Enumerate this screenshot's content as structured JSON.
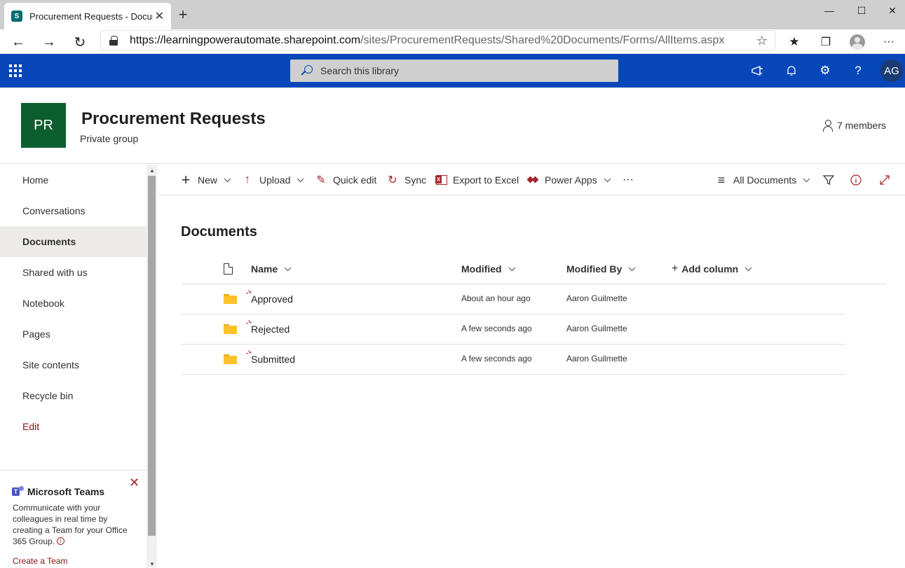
{
  "browser": {
    "tab_title": "Procurement Requests - Documents",
    "favicon_letter": "S",
    "url_host": "https://learningpowerautomate.sharepoint.com",
    "url_path": "/sites/ProcurementRequests/Shared%20Documents/Forms/AllItems.aspx",
    "minimize_glyph": "—",
    "maximize_glyph": "☐",
    "close_glyph": "✕",
    "new_tab_glyph": "+",
    "back_glyph": "←",
    "forward_glyph": "→",
    "refresh_glyph": "↻",
    "star_glyph": "☆",
    "favorites_glyph": "★",
    "menu_glyph": "···"
  },
  "suitebar": {
    "search_placeholder": "Search this library",
    "avatar_initials": "AG",
    "help_glyph": "?",
    "settings_glyph": "⚙",
    "bell_glyph": "🔔",
    "feedback_glyph": "📢"
  },
  "site": {
    "logo_initials": "PR",
    "title": "Procurement Requests",
    "subtitle": "Private group",
    "members": "7 members"
  },
  "leftnav": {
    "items": [
      {
        "label": "Home"
      },
      {
        "label": "Conversations"
      },
      {
        "label": "Documents"
      },
      {
        "label": "Shared with us"
      },
      {
        "label": "Notebook"
      },
      {
        "label": "Pages"
      },
      {
        "label": "Site contents"
      },
      {
        "label": "Recycle bin"
      },
      {
        "label": "Edit"
      }
    ],
    "selected": "Documents"
  },
  "teams_card": {
    "title": "Microsoft Teams",
    "description": "Communicate with your colleagues in real time by creating a Team for your Office 365 Group.",
    "link": "Create a Team",
    "close_glyph": "✕",
    "info_glyph": "i"
  },
  "commandbar": {
    "new": "New",
    "upload": "Upload",
    "quick_edit": "Quick edit",
    "sync": "Sync",
    "export": "Export to Excel",
    "power_apps": "Power Apps",
    "more": "···",
    "view": "All Documents",
    "new_glyph": "+",
    "upload_glyph": "↑",
    "edit_glyph": "✎",
    "sync_glyph": "↻",
    "view_glyph": "≡",
    "filter_glyph": "▽",
    "info_glyph": "ⓘ",
    "expand_glyph": "⤢"
  },
  "library": {
    "title": "Documents",
    "columns": {
      "name": "Name",
      "modified": "Modified",
      "modified_by": "Modified By",
      "add_column": "Add column",
      "add_glyph": "+"
    },
    "rows": [
      {
        "name": "Approved",
        "modified": "About an hour ago",
        "modified_by": "Aaron Guilmette"
      },
      {
        "name": "Rejected",
        "modified": "A few seconds ago",
        "modified_by": "Aaron Guilmette"
      },
      {
        "name": "Submitted",
        "modified": "A few seconds ago",
        "modified_by": "Aaron Guilmette"
      }
    ]
  },
  "colors": {
    "suitebar": "#0747b9",
    "site_logo": "#0d5e2e",
    "accent": "#a4262c"
  }
}
